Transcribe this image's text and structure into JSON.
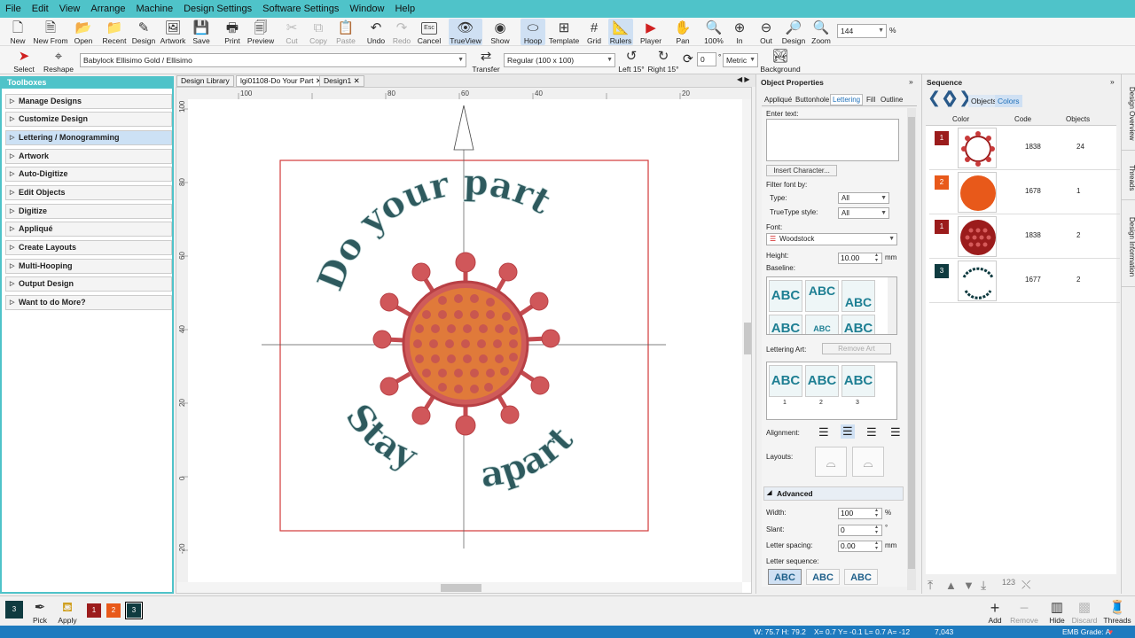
{
  "menu": [
    "File",
    "Edit",
    "View",
    "Arrange",
    "Machine",
    "Design Settings",
    "Software Settings",
    "Window",
    "Help"
  ],
  "toolbar": {
    "new": "New",
    "new_from": "New From",
    "open": "Open",
    "recent": "Recent",
    "design": "Design",
    "artwork": "Artwork",
    "save": "Save",
    "print": "Print",
    "preview": "Preview",
    "cut": "Cut",
    "copy": "Copy",
    "paste": "Paste",
    "undo": "Undo",
    "redo": "Redo",
    "cancel": "Cancel",
    "esc": "Esc",
    "trueview": "TrueView",
    "show": "Show",
    "hoop": "Hoop",
    "template": "Template",
    "grid": "Grid",
    "rulers": "Rulers",
    "player": "Player",
    "pan": "Pan",
    "zoom100": "100%",
    "zoom_in": "In",
    "zoom_out": "Out",
    "zoom_design": "Design",
    "zoom": "Zoom",
    "zoom_value": "144",
    "zoom_unit": "%"
  },
  "toolbar2": {
    "select": "Select",
    "reshape": "Reshape",
    "thread_chart": "Babylock Ellisimo Gold / Ellisimo",
    "transfer": "Transfer",
    "hoop_size": "Regular (100 x 100)",
    "left15": "Left 15°",
    "right15": "Right 15°",
    "angle": "0",
    "degree": "°",
    "units": "Metric",
    "background": "Background"
  },
  "toolboxes": {
    "title": "Toolboxes",
    "items": [
      "Manage Designs",
      "Customize Design",
      "Lettering / Monogramming",
      "Artwork",
      "Auto-Digitize",
      "Edit Objects",
      "Digitize",
      "Appliqué",
      "Create Layouts",
      "Multi-Hooping",
      "Output Design",
      "Want to do More?"
    ],
    "active": 2
  },
  "doc_tabs": [
    {
      "label": "Design Library",
      "closable": false
    },
    {
      "label": "lgi01108-Do Your Part",
      "closable": true
    },
    {
      "label": "Design1",
      "closable": true
    }
  ],
  "rulers": {
    "top": [
      "100",
      "80",
      "60",
      "40",
      "20"
    ],
    "left": [
      "100",
      "80",
      "60",
      "40",
      "20",
      "0",
      "-20"
    ]
  },
  "design": {
    "top_text": "Do your part",
    "bottom_left": "Stay",
    "bottom_right": "apart",
    "text_color": "#2e5a5e",
    "virus_color": "#d0575a",
    "inner_color": "#e07a3a",
    "hoop_color": "#d33a3a"
  },
  "properties": {
    "title": "Object Properties",
    "tabs": [
      "Appliqué",
      "Buttonhole",
      "Lettering",
      "Fill",
      "Outline"
    ],
    "active_tab": 2,
    "enter_text_label": "Enter text:",
    "enter_text_value": "",
    "insert_char": "Insert Character...",
    "filter_label": "Filter font by:",
    "type_label": "Type:",
    "type_value": "All",
    "truetype_label": "TrueType style:",
    "truetype_value": "All",
    "font_label": "Font:",
    "font_value": "Woodstock",
    "height_label": "Height:",
    "height_value": "10.00",
    "height_unit": "mm",
    "baseline_label": "Baseline:",
    "baseline_sample": "ABC",
    "lettering_art_label": "Lettering Art:",
    "remove_art": "Remove Art",
    "art_numbers": [
      "1",
      "2",
      "3"
    ],
    "alignment_label": "Alignment:",
    "layouts_label": "Layouts:",
    "advanced": "Advanced",
    "width_label": "Width:",
    "width_value": "100",
    "width_unit": "%",
    "slant_label": "Slant:",
    "slant_value": "0",
    "slant_unit": "°",
    "spacing_label": "Letter spacing:",
    "spacing_value": "0.00",
    "spacing_unit": "mm",
    "sequence_label": "Letter sequence:"
  },
  "sequence": {
    "title": "Sequence",
    "tabs": [
      "Objects",
      "Colors"
    ],
    "headers": [
      "Color",
      "Code",
      "Objects"
    ],
    "rows": [
      {
        "num": "1",
        "color": "#9b1c1c",
        "code": "1838",
        "objects": "24"
      },
      {
        "num": "2",
        "color": "#e8591a",
        "code": "1678",
        "objects": "1"
      },
      {
        "num": "1",
        "color": "#9b1c1c",
        "code": "1838",
        "objects": "2"
      },
      {
        "num": "3",
        "color": "#0f3b40",
        "code": "1677",
        "objects": "2"
      }
    ],
    "order_num": "123"
  },
  "side_tabs": [
    "Design Overview",
    "Threads",
    "Design Information"
  ],
  "bottom": {
    "current": "3",
    "pick": "Pick",
    "apply": "Apply",
    "palette": [
      {
        "n": "1",
        "c": "#9b1c1c"
      },
      {
        "n": "2",
        "c": "#e8591a"
      },
      {
        "n": "3",
        "c": "#0f3b40"
      }
    ],
    "add": "Add",
    "remove": "Remove",
    "hide": "Hide",
    "discard": "Discard",
    "threads": "Threads"
  },
  "status": {
    "size": "W: 75.7 H: 79.2",
    "coords": "X=  0.7 Y= -0.1 L=  0.7 A= -12",
    "stitches": "7,043",
    "grade": "EMB Grade: A"
  }
}
